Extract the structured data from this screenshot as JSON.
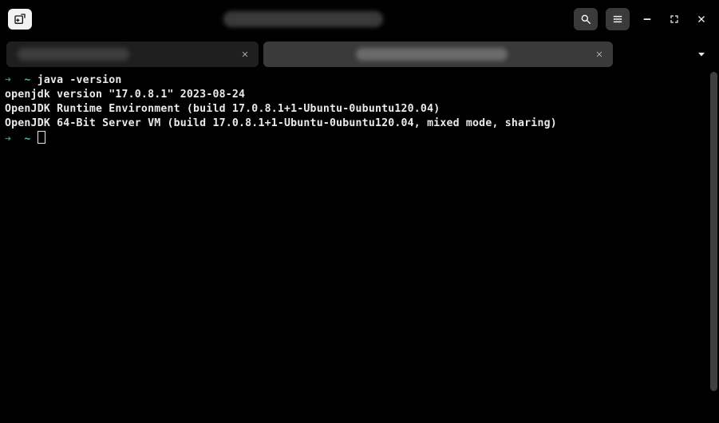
{
  "title": "(hidden)",
  "tabs": {
    "items": [
      {
        "label": "(hidden)",
        "active": false
      },
      {
        "label": "(hidden)",
        "active": true
      }
    ]
  },
  "prompt": {
    "arrow": "➜",
    "path": "~"
  },
  "session": {
    "command": "java -version",
    "output": [
      "openjdk version \"17.0.8.1\" 2023-08-24",
      "OpenJDK Runtime Environment (build 17.0.8.1+1-Ubuntu-0ubuntu120.04)",
      "OpenJDK 64-Bit Server VM (build 17.0.8.1+1-Ubuntu-0ubuntu120.04, mixed mode, sharing)"
    ]
  },
  "icons": {
    "new_tab": "new-tab-icon",
    "search": "search-icon",
    "menu": "menu-icon",
    "minimize": "minimize-icon",
    "maximize": "maximize-icon",
    "close": "close-icon",
    "tab_close": "close-icon",
    "tabs_dropdown": "chevron-down-icon"
  }
}
